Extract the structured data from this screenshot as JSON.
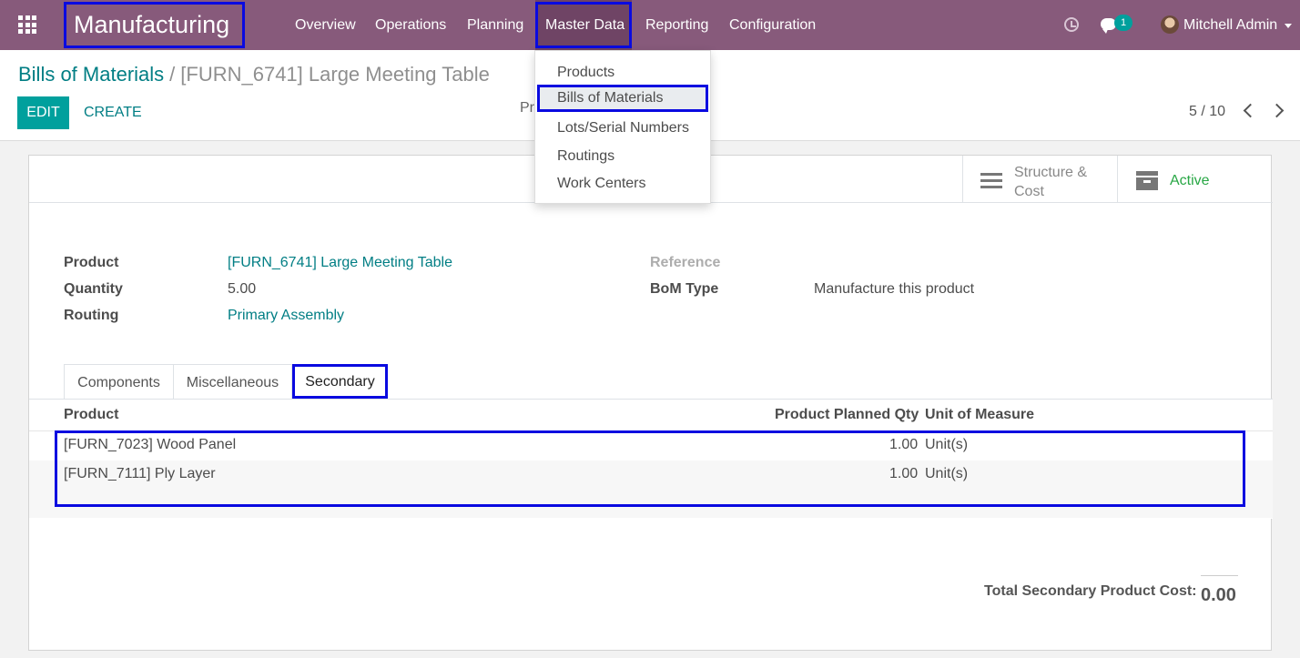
{
  "navbar": {
    "brand": "Manufacturing",
    "menu": [
      "Overview",
      "Operations",
      "Planning",
      "Master Data",
      "Reporting",
      "Configuration"
    ],
    "chat_count": "1",
    "user": "Mitchell Admin"
  },
  "dropdown": {
    "items": [
      "Products",
      "Bills of Materials",
      "Lots/Serial Numbers",
      "Routings",
      "Work Centers"
    ],
    "selected": "Bills of Materials"
  },
  "control_panel": {
    "breadcrumb_parent": "Bills of Materials",
    "breadcrumb_separator": "/",
    "breadcrumb_current": "[FURN_6741] Large Meeting Table",
    "edit_label": "EDIT",
    "create_label": "CREATE",
    "partial_text": "Pr",
    "pager": "5 / 10"
  },
  "smart_buttons": {
    "structure_label": "Structure & Cost",
    "active_label": "Active"
  },
  "form": {
    "product_label": "Product",
    "product_value": "[FURN_6741] Large Meeting Table",
    "quantity_label": "Quantity",
    "quantity_value": "5.00",
    "routing_label": "Routing",
    "routing_value": "Primary Assembly",
    "reference_label": "Reference",
    "bom_type_label": "BoM Type",
    "bom_type_value": "Manufacture this product"
  },
  "tabs": [
    "Components",
    "Miscellaneous",
    "Secondary"
  ],
  "table": {
    "headers": [
      "Product",
      "Product Planned Qty",
      "Unit of Measure"
    ],
    "rows": [
      {
        "product": "[FURN_7023] Wood Panel",
        "qty": "1.00",
        "uom": "Unit(s)"
      },
      {
        "product": "[FURN_7111] Ply Layer",
        "qty": "1.00",
        "uom": "Unit(s)"
      }
    ]
  },
  "totals": {
    "label": "Total Secondary Product Cost:",
    "value": "0.00"
  },
  "colors": {
    "navbar": "#875a7b",
    "accent": "#00a09d",
    "link": "#017e84",
    "highlight_box": "#0a0ae0",
    "active_green": "#28a745"
  }
}
